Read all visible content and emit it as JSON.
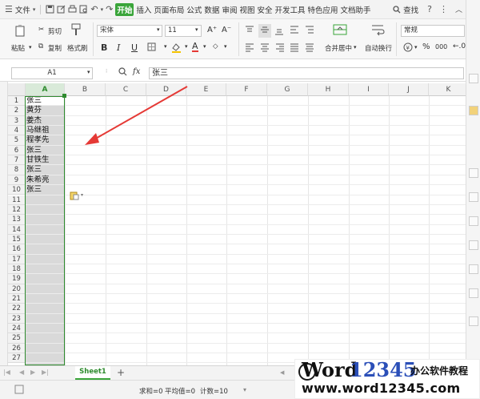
{
  "menubar": {
    "file_label": "文件",
    "tabs": [
      "开始",
      "插入",
      "页面布局",
      "公式",
      "数据",
      "审阅",
      "视图",
      "安全",
      "开发工具",
      "特色应用",
      "文档助手"
    ],
    "active_tab": "开始",
    "search_label": "查找",
    "accent_color": "#3aa53a"
  },
  "toolbar": {
    "cut": "剪切",
    "paste": "粘贴",
    "copy": "复制",
    "format_painter": "格式刷",
    "font_name": "宋体",
    "font_size": "11",
    "merge_center": "合并居中",
    "wrap_text": "自动换行",
    "number_format": "常规",
    "bold": "B",
    "italic": "I",
    "underline": "U",
    "grow": "A⁺",
    "shrink": "A⁻",
    "percent": "%",
    "thousands": "000",
    "font_color_letter": "A"
  },
  "formula_bar": {
    "name_box": "A1",
    "fx": "fx",
    "content": "张三"
  },
  "grid": {
    "columns": [
      "A",
      "B",
      "C",
      "D",
      "E",
      "F",
      "G",
      "H",
      "I",
      "J",
      "K"
    ],
    "row_numbers": [
      "1",
      "2",
      "3",
      "4",
      "5",
      "6",
      "7",
      "8",
      "9",
      "10",
      "11",
      "12",
      "13",
      "14",
      "15",
      "16",
      "17",
      "18",
      "19",
      "20",
      "21",
      "22",
      "23",
      "24",
      "25",
      "26",
      "27"
    ],
    "column_a": [
      "张三",
      "黄芬",
      "姜杰",
      "马继祖",
      "程孝先",
      "张三",
      "甘铁生",
      "张三",
      "朱希亮",
      "张三"
    ]
  },
  "sheet_tabs": {
    "active": "Sheet1",
    "add": "+"
  },
  "status": {
    "sum": "求和=0",
    "average": "平均值=0",
    "count": "计数=10"
  },
  "watermark": {
    "brand_a": "Word",
    "brand_b": "12345",
    "brand_c": "办公软件教程",
    "url": "www.word12345.com"
  },
  "colors": {
    "selection": "#2e8b2e",
    "arrow": "#e53935"
  }
}
